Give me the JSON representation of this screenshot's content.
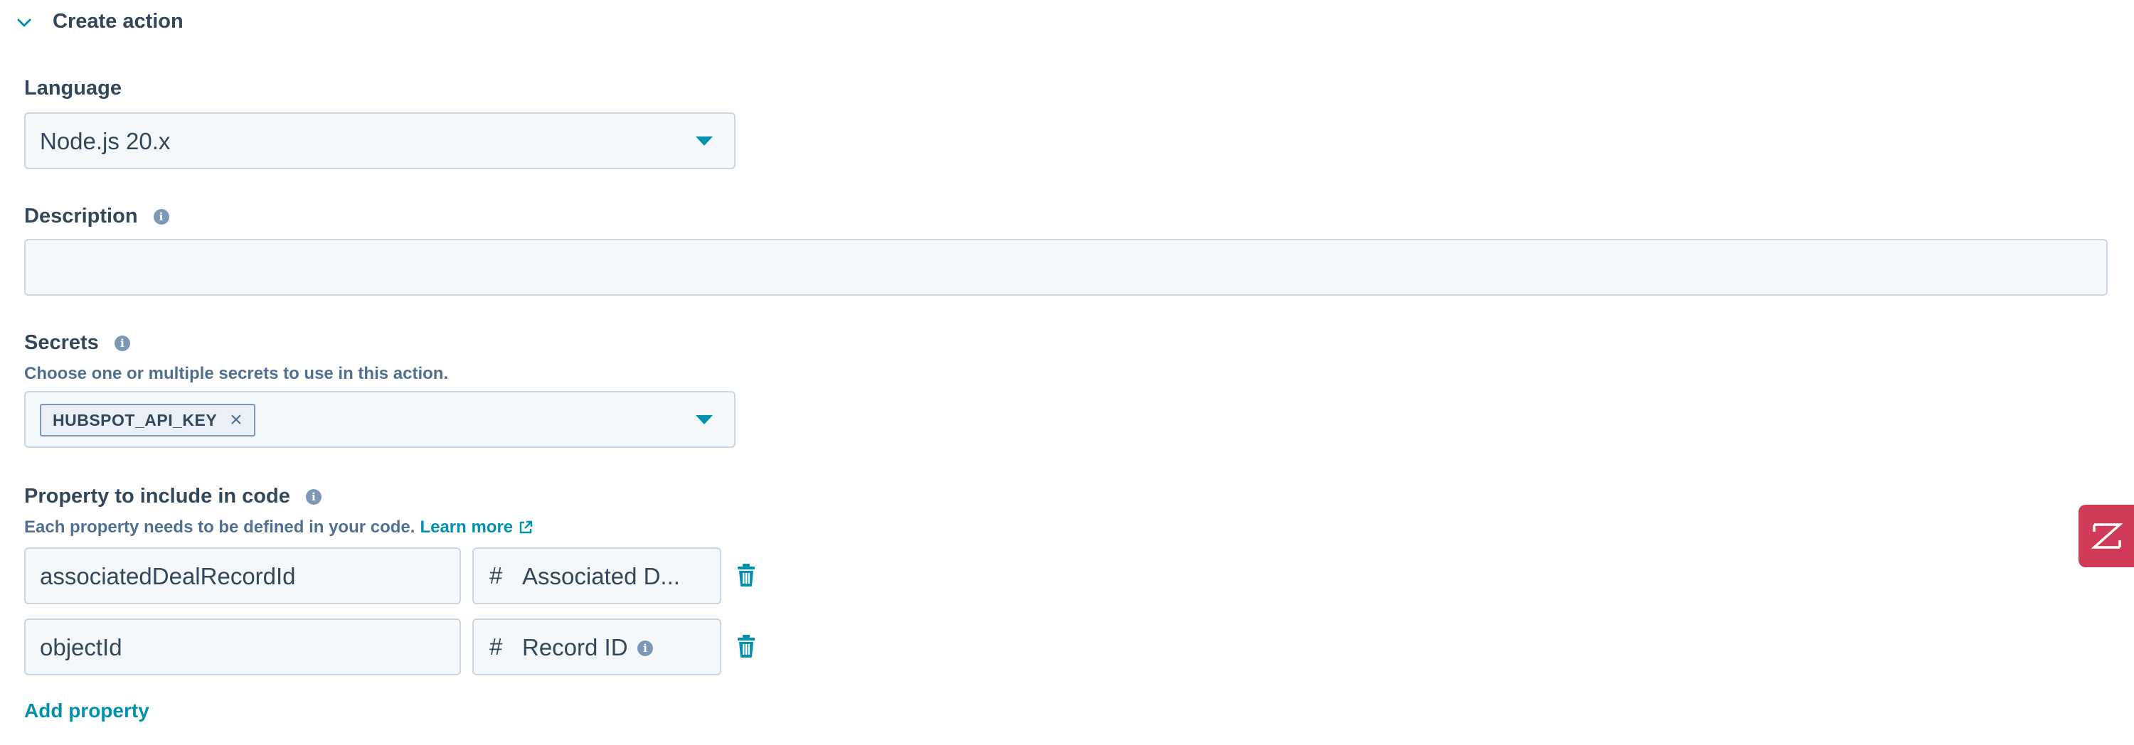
{
  "section": {
    "title": "Create action"
  },
  "language": {
    "label": "Language",
    "selected": "Node.js 20.x"
  },
  "description": {
    "label": "Description",
    "value": "",
    "placeholder": ""
  },
  "secrets": {
    "label": "Secrets",
    "help": "Choose one or multiple secrets to use in this action.",
    "tags": [
      "HUBSPOT_API_KEY"
    ]
  },
  "properties": {
    "label": "Property to include in code",
    "help": "Each property needs to be defined in your code.",
    "learn_more": "Learn more",
    "rows": [
      {
        "variable": "associatedDealRecordId",
        "property": "Associated D..."
      },
      {
        "variable": "objectId",
        "property": "Record ID"
      }
    ],
    "add_label": "Add property"
  },
  "icons": {
    "chevron": "chevron-down-icon",
    "info": "info-icon",
    "caret": "caret-down-icon",
    "close": "close-icon",
    "external": "external-link-icon",
    "hash": "hash-icon",
    "trash": "trash-icon",
    "side": "zendesk-logo-icon"
  },
  "colors": {
    "accent": "#0091ae",
    "text": "#33475b",
    "field_bg": "#f5f8fa",
    "field_border": "#cbd6e2",
    "side_button": "#d13b5a"
  }
}
